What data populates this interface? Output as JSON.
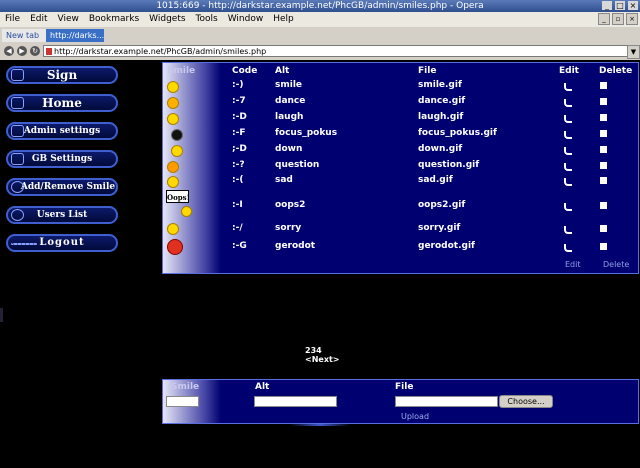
{
  "window": {
    "title": "1015:669 - http://darkstar.example.net/PhcGB/admin/smiles.php - Opera"
  },
  "menu": [
    "File",
    "Edit",
    "View",
    "Bookmarks",
    "Widgets",
    "Tools",
    "Window",
    "Help"
  ],
  "tabs": [
    {
      "label": "New tab"
    },
    {
      "label": "http://darks..."
    }
  ],
  "address": {
    "url": "http://darkstar.example.net/PhcGB/admin/smiles.php"
  },
  "sidebar": {
    "items": [
      {
        "label": "Sign"
      },
      {
        "label": "Home"
      },
      {
        "label": "Admin settings"
      },
      {
        "label": "GB Settings"
      },
      {
        "label": "Add/Remove Smile"
      },
      {
        "label": "Users List"
      },
      {
        "label": "Logout"
      }
    ]
  },
  "table": {
    "headers": {
      "smile": "Smile",
      "code": "Code",
      "alt": "Alt",
      "file": "File",
      "edit": "Edit",
      "delete": "Delete"
    },
    "rows": [
      {
        "code": ":-)",
        "alt": "smile",
        "file": "smile.gif"
      },
      {
        "code": ":-7",
        "alt": "dance",
        "file": "dance.gif"
      },
      {
        "code": ":-D",
        "alt": "laugh",
        "file": "laugh.gif"
      },
      {
        "code": ":-F",
        "alt": "focus_pokus",
        "file": "focus_pokus.gif"
      },
      {
        "code": ";-D",
        "alt": "down",
        "file": "down.gif"
      },
      {
        "code": ":-?",
        "alt": "question",
        "file": "question.gif"
      },
      {
        "code": ":-(",
        "alt": "sad",
        "file": "sad.gif"
      },
      {
        "code": ":-I",
        "alt": "oops2",
        "file": "oops2.gif",
        "badge": "Oops!"
      },
      {
        "code": ":-/",
        "alt": "sorry",
        "file": "sorry.gif"
      },
      {
        "code": ":-G",
        "alt": "gerodot",
        "file": "gerodot.gif"
      }
    ],
    "footer": {
      "edit": "Edit",
      "delete": "Delete"
    }
  },
  "pagination": {
    "pages": "234",
    "next": "<Next>"
  },
  "add_form": {
    "smile_label": "Smile",
    "alt_label": "Alt",
    "file_label": "File",
    "choose_label": "Choose...",
    "upload_label": "Upload"
  },
  "colors": {
    "panel": "#000070",
    "border": "#5a6ee0",
    "sidebar_border": "#3f5fd0"
  }
}
